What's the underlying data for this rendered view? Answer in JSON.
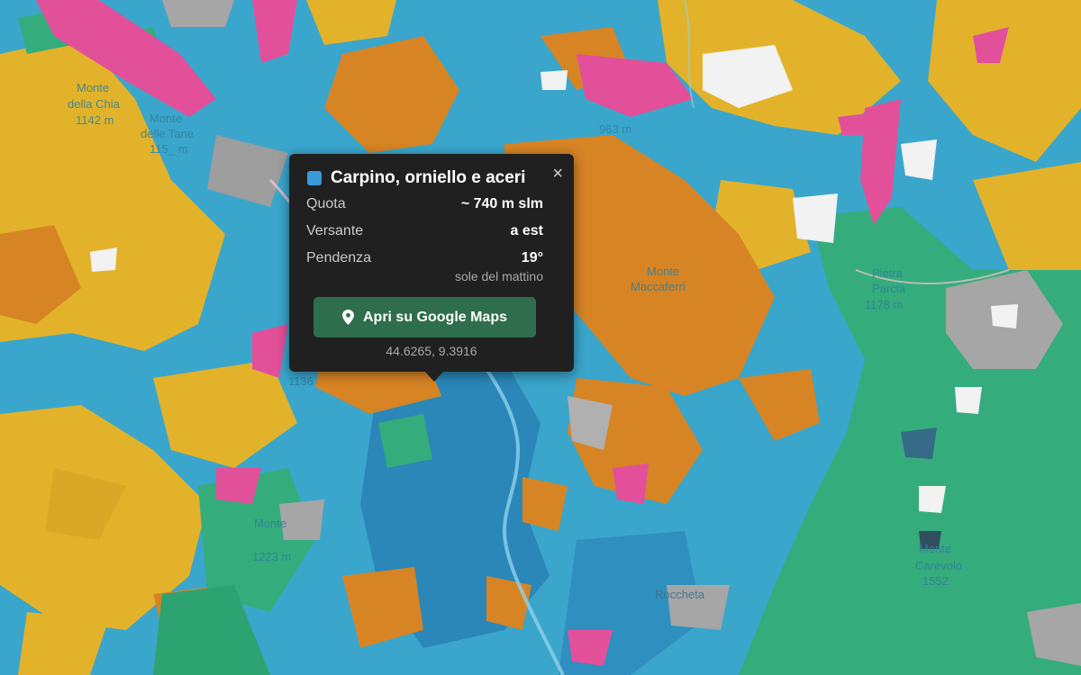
{
  "map": {
    "colors": {
      "water_forest": "#3aa6cc",
      "deep_forest": "#2a87b8",
      "chestnut": "#d78424",
      "beech": "#e2b32a",
      "conifer": "#35ac7c",
      "shrub": "#e2509a",
      "rock": "#a6a6a6",
      "open": "#f2f2f2"
    },
    "labels": [
      {
        "name": "Monte",
        "sub": "della Chia",
        "elev": "1142 m"
      },
      {
        "name": "Monte",
        "sub": "delle Tane",
        "elev": "115_ m"
      },
      {
        "name": "Monte",
        "sub": "Maccaferri",
        "elev": ""
      },
      {
        "name": "Pietra",
        "sub": "Parcia",
        "elev": "1178 m"
      },
      {
        "name": "Monte",
        "sub": "",
        "elev": "1223 m"
      },
      {
        "name": "Roccheta",
        "sub": "",
        "elev": ""
      },
      {
        "name": "Monte",
        "sub": "Carevolo",
        "elev": "1552"
      },
      {
        "name": "1136",
        "sub": "",
        "elev": ""
      },
      {
        "name": "963 m",
        "sub": "",
        "elev": ""
      }
    ]
  },
  "popup": {
    "swatch_color": "#3a9ad9",
    "title": "Carpino, orniello e aceri",
    "close_label": "×",
    "rows": [
      {
        "key": "Quota",
        "value": "~ 740 m slm"
      },
      {
        "key": "Versante",
        "value": "a est"
      },
      {
        "key": "Pendenza",
        "value": "19°"
      }
    ],
    "note": "sole del mattino",
    "button_label": "Apri su Google Maps",
    "button_icon": "map-pin-icon",
    "coordinates": "44.6265, 9.3916"
  }
}
